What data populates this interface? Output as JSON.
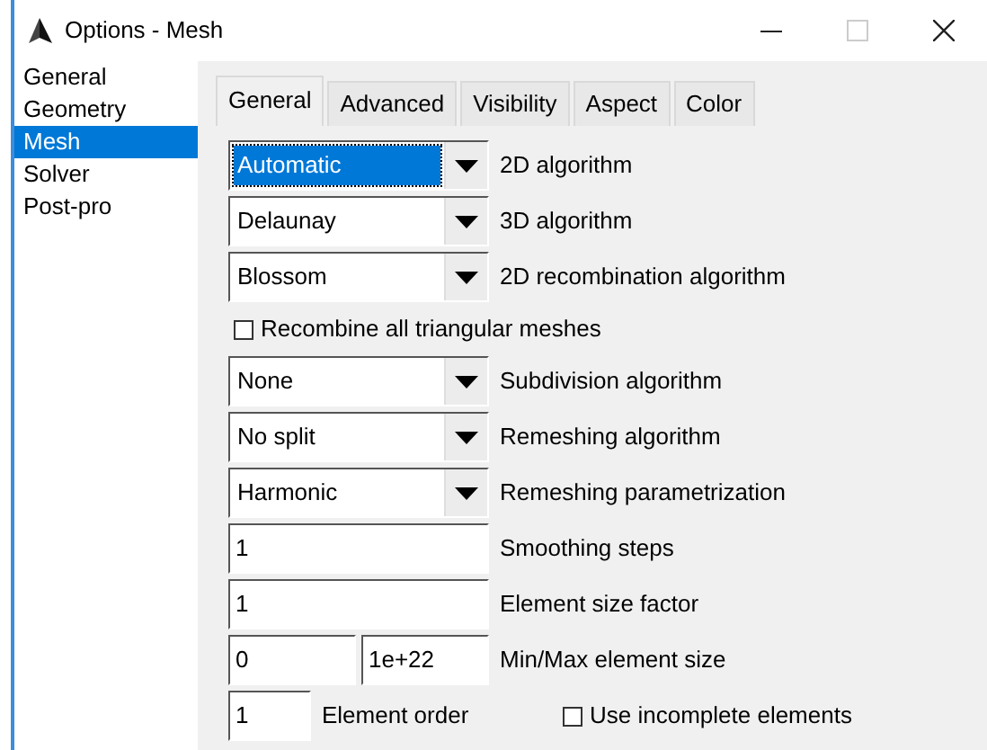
{
  "window": {
    "title": "Options - Mesh"
  },
  "sidebar": {
    "items": [
      {
        "label": "General",
        "selected": false
      },
      {
        "label": "Geometry",
        "selected": false
      },
      {
        "label": "Mesh",
        "selected": true
      },
      {
        "label": "Solver",
        "selected": false
      },
      {
        "label": "Post-pro",
        "selected": false
      }
    ]
  },
  "tabs": [
    {
      "label": "General",
      "selected": true
    },
    {
      "label": "Advanced",
      "selected": false
    },
    {
      "label": "Visibility",
      "selected": false
    },
    {
      "label": "Aspect",
      "selected": false
    },
    {
      "label": "Color",
      "selected": false
    }
  ],
  "algorithms": [
    {
      "kind": "dropdown",
      "value": "Automatic",
      "focused": true,
      "label": "2D algorithm"
    },
    {
      "kind": "dropdown",
      "value": "Delaunay",
      "focused": false,
      "label": "3D algorithm"
    },
    {
      "kind": "dropdown",
      "value": "Blossom",
      "focused": false,
      "label": "2D recombination algorithm"
    }
  ],
  "recombine_checkbox": {
    "checked": false,
    "label": "Recombine all triangular meshes"
  },
  "settings": [
    {
      "kind": "dropdown",
      "value": "None",
      "focused": false,
      "label": "Subdivision algorithm"
    },
    {
      "kind": "dropdown",
      "value": "No split",
      "focused": false,
      "label": "Remeshing algorithm"
    },
    {
      "kind": "dropdown",
      "value": "Harmonic",
      "focused": false,
      "label": "Remeshing parametrization"
    },
    {
      "kind": "input",
      "value": "1",
      "label": "Smoothing steps"
    },
    {
      "kind": "input",
      "value": "1",
      "label": "Element size factor"
    },
    {
      "kind": "pair",
      "values": [
        "0",
        "1e+22"
      ],
      "label": "Min/Max element size"
    },
    {
      "kind": "order",
      "value": "1",
      "label": "Element order",
      "checkbox": {
        "checked": false,
        "label": "Use incomplete elements"
      }
    }
  ]
}
